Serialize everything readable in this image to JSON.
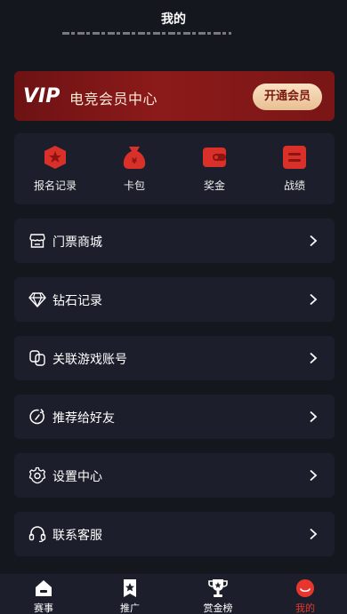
{
  "header": {
    "title": "我的"
  },
  "vip": {
    "badge": "VIP",
    "title": "电竞会员中心",
    "button_label": "开通会员"
  },
  "quick_menu": [
    {
      "label": "报名记录",
      "icon": "registration-record-icon"
    },
    {
      "label": "卡包",
      "icon": "card-bag-icon"
    },
    {
      "label": "奖金",
      "icon": "wallet-icon"
    },
    {
      "label": "战绩",
      "icon": "record-list-icon"
    }
  ],
  "menu_rows": [
    {
      "label": "门票商城",
      "icon": "store-icon"
    },
    {
      "label": "钻石记录",
      "icon": "diamond-icon"
    },
    {
      "label": "关联游戏账号",
      "icon": "link-icon"
    },
    {
      "label": "推荐给好友",
      "icon": "share-icon"
    },
    {
      "label": "设置中心",
      "icon": "gear-icon"
    },
    {
      "label": "联系客服",
      "icon": "headset-icon"
    }
  ],
  "tabbar": [
    {
      "label": "赛事",
      "icon": "home-icon",
      "active": false
    },
    {
      "label": "推广",
      "icon": "promote-icon",
      "active": false
    },
    {
      "label": "赏金榜",
      "icon": "trophy-icon",
      "active": false
    },
    {
      "label": "我的",
      "icon": "profile-icon",
      "active": true
    }
  ],
  "colors": {
    "background": "#15171f",
    "card": "#1c1f2b",
    "accent_red": "#e8362e",
    "vip_gold": "#f0caa0"
  }
}
